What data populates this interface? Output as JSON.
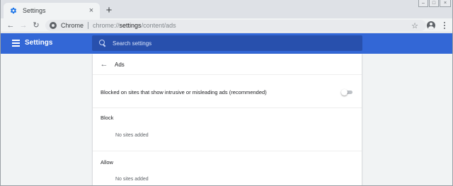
{
  "browser": {
    "tab": {
      "title": "Settings",
      "close_glyph": "×"
    },
    "new_tab_glyph": "+",
    "window_controls": {
      "minimize": "–",
      "maximize": "□",
      "close": "×"
    },
    "nav": {
      "back": "←",
      "forward": "→",
      "reload": "↻"
    },
    "omnibox": {
      "chip": "Chrome",
      "url_prefix": "chrome://",
      "url_host": "settings",
      "url_path": "/content/ads"
    },
    "star_glyph": "☆"
  },
  "settings": {
    "title": "Settings",
    "search_placeholder": "Search settings"
  },
  "ads_page": {
    "back_glyph": "←",
    "title": "Ads",
    "toggle_label": "Blocked on sites that show intrusive or misleading ads (recommended)",
    "toggle_on": false,
    "block_heading": "Block",
    "block_empty": "No sites added",
    "allow_heading": "Allow",
    "allow_empty": "No sites added"
  },
  "colors": {
    "header_blue": "#3367d6",
    "search_blue": "#2850ad",
    "page_bg": "#f1f3f4"
  },
  "icons": [
    "gear-icon",
    "close-icon",
    "plus-icon",
    "back-arrow-icon",
    "forward-arrow-icon",
    "reload-icon",
    "site-info-icon",
    "star-icon",
    "profile-icon",
    "menu-dots-icon",
    "hamburger-icon",
    "search-icon"
  ]
}
